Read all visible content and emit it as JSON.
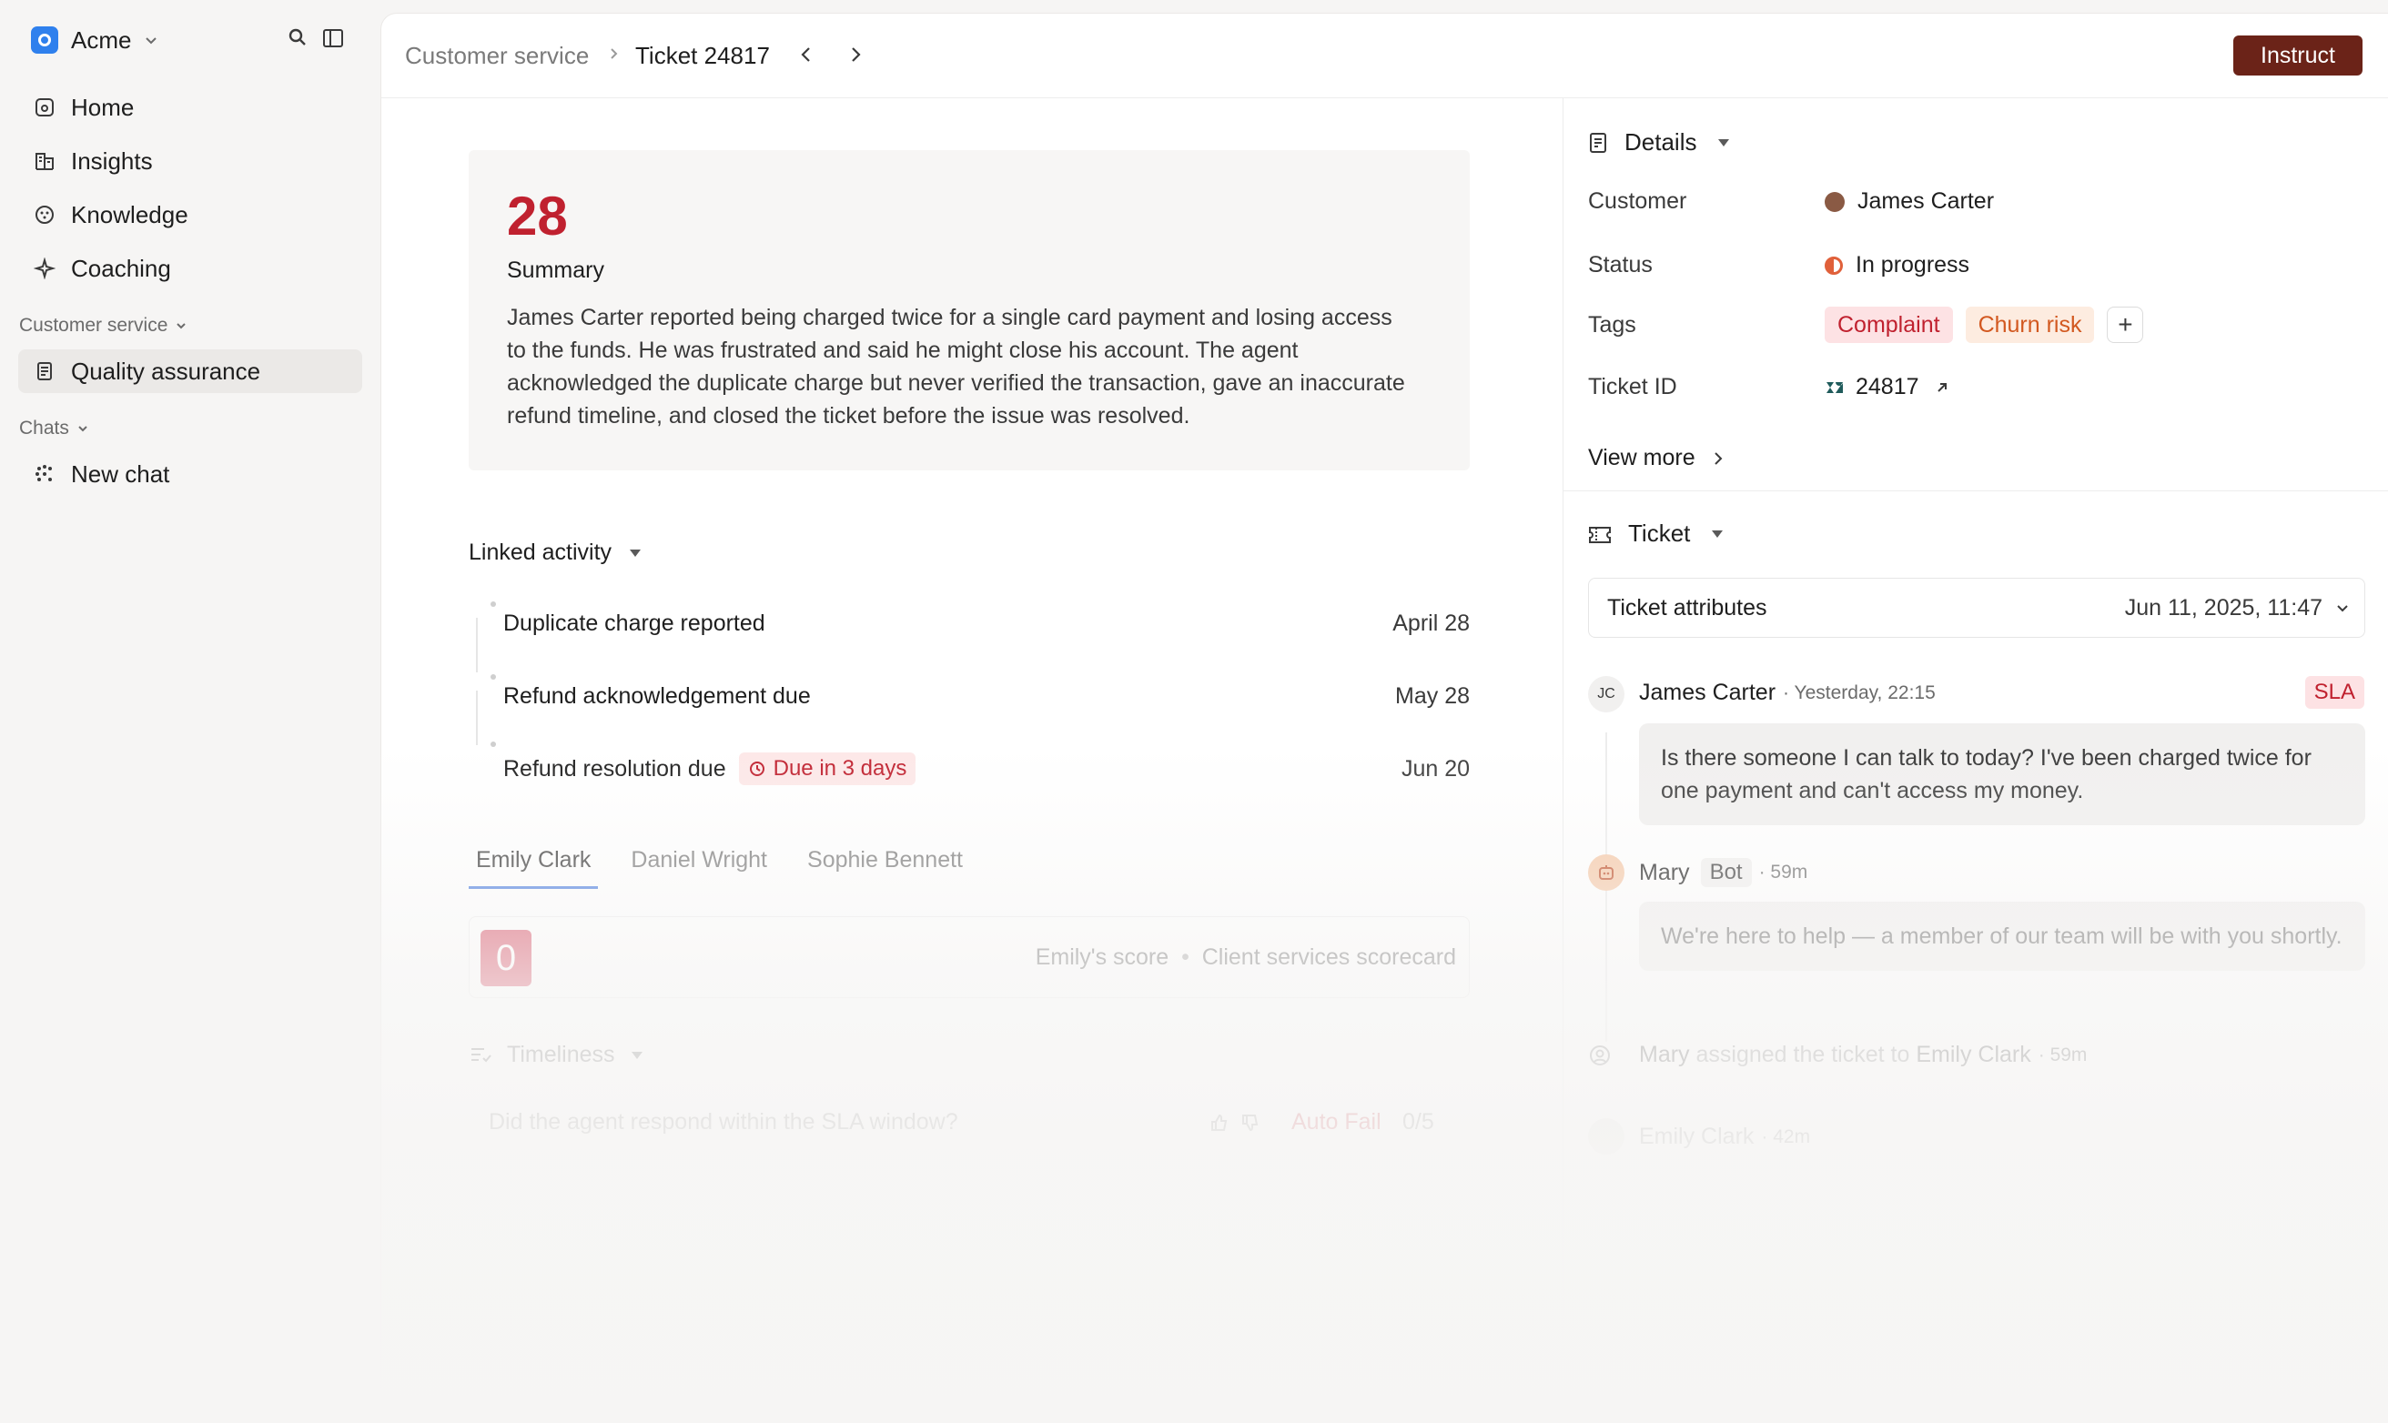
{
  "workspace": {
    "name": "Acme"
  },
  "sidebar": {
    "items": [
      {
        "label": "Home",
        "icon": "home-icon"
      },
      {
        "label": "Insights",
        "icon": "insights-icon"
      },
      {
        "label": "Knowledge",
        "icon": "knowledge-icon"
      },
      {
        "label": "Coaching",
        "icon": "sparkle-icon"
      }
    ],
    "section_customer_service": "Customer service",
    "quality_assurance": "Quality assurance",
    "section_chats": "Chats",
    "new_chat": "New chat"
  },
  "header": {
    "breadcrumb_parent": "Customer service",
    "breadcrumb_current": "Ticket 24817",
    "instruct_label": "Instruct"
  },
  "summary": {
    "score": "28",
    "title": "Summary",
    "text": "James Carter reported being charged twice for a single card payment and losing access to the funds. He was frustrated and said he might close his account. The agent acknowledged the duplicate charge but never verified the transaction, gave an inaccurate refund timeline, and closed the ticket before the issue was resolved."
  },
  "linked_activity": {
    "title": "Linked activity",
    "items": [
      {
        "label": "Duplicate charge reported",
        "date": "April 28"
      },
      {
        "label": "Refund acknowledgement due",
        "date": "May 28"
      },
      {
        "label": "Refund resolution due",
        "date": "Jun 20",
        "badge": "Due in 3 days"
      }
    ]
  },
  "agent_tabs": [
    "Emily Clark",
    "Daniel Wright",
    "Sophie Bennett"
  ],
  "scorecard": {
    "score": "0",
    "label": "Emily's score",
    "sep": "•",
    "name": "Client services scorecard"
  },
  "timeliness": {
    "title": "Timeliness",
    "question": "Did the agent respond within the SLA window?",
    "result": "Auto Fail",
    "points": "0/5"
  },
  "details": {
    "title": "Details",
    "customer_label": "Customer",
    "customer_value": "James Carter",
    "status_label": "Status",
    "status_value": "In progress",
    "tags_label": "Tags",
    "tags": [
      "Complaint",
      "Churn risk"
    ],
    "add_tag": "+",
    "ticket_id_label": "Ticket ID",
    "ticket_id_value": "24817",
    "view_more": "View more"
  },
  "ticket": {
    "title": "Ticket",
    "attributes_label": "Ticket attributes",
    "attributes_date": "Jun 11, 2025, 11:47",
    "sla": "SLA",
    "messages": [
      {
        "initials": "JC",
        "name": "James Carter",
        "meta": "· Yesterday, 22:15",
        "text": "Is there someone I can talk to today? I've been charged twice for one payment and can't access my money."
      },
      {
        "name": "Mary",
        "tag": "Bot",
        "meta": "· 59m",
        "text": "We're here to help — a member of our team will be with you shortly."
      }
    ],
    "event": {
      "actor": "Mary",
      "action": "assigned the ticket to",
      "target": "Emily Clark",
      "meta": "· 59m"
    },
    "next": {
      "name": "Emily Clark",
      "meta": "· 42m"
    }
  },
  "colors": {
    "accent": "#6b2318",
    "score_red": "#c0212f",
    "tab_underline": "#4a7de0"
  }
}
